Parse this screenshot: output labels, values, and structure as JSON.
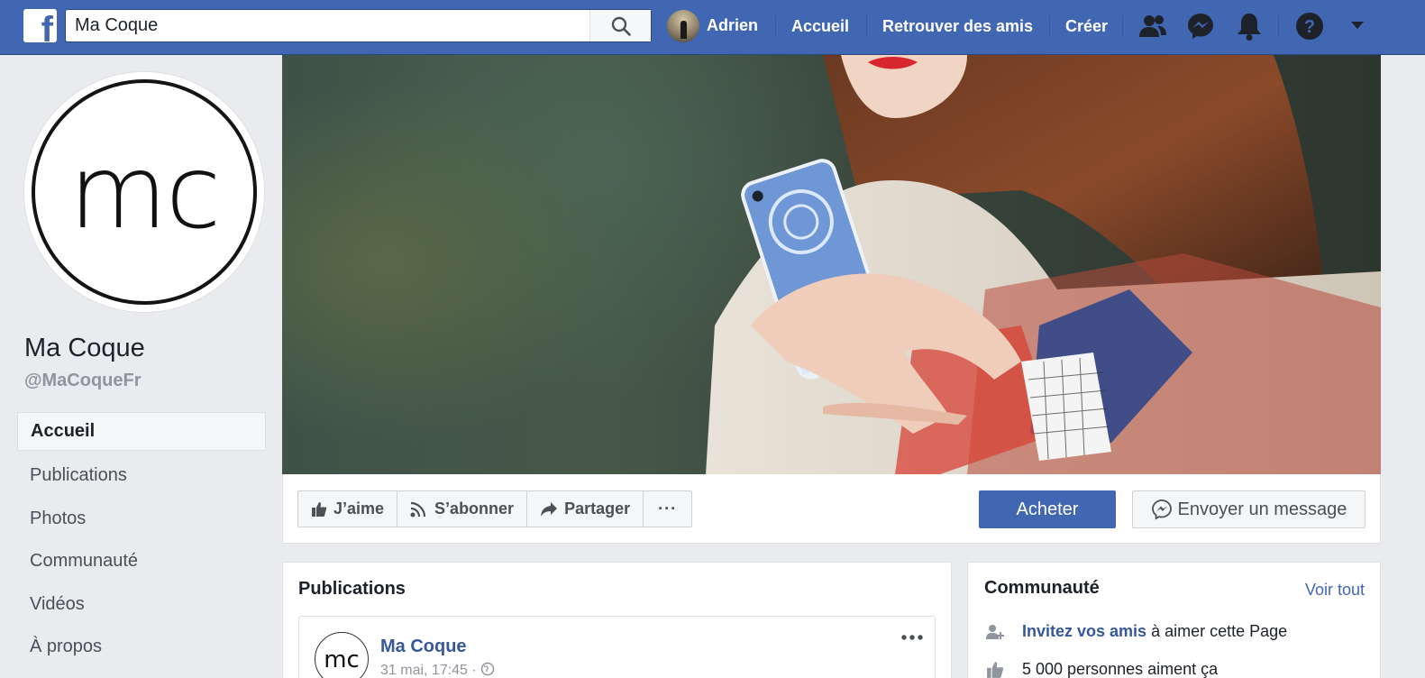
{
  "topbar": {
    "logo": "f",
    "search_value": "Ma Coque",
    "user_name": "Adrien",
    "links": [
      "Accueil",
      "Retrouver des amis",
      "Créer"
    ],
    "icons": [
      "friends-icon",
      "messenger-icon",
      "notifications-icon",
      "help-icon",
      "dropdown-icon"
    ]
  },
  "profile": {
    "logo_text": "mc",
    "name": "Ma Coque",
    "handle": "@MaCoqueFr"
  },
  "leftnav": {
    "items": [
      "Accueil",
      "Publications",
      "Photos",
      "Communauté",
      "Vidéos",
      "À propos"
    ]
  },
  "actions": {
    "like": "J’aime",
    "subscribe": "S’abonner",
    "share": "Partager",
    "more": "···",
    "buy": "Acheter",
    "message": "Envoyer un message"
  },
  "publications": {
    "title": "Publications",
    "post": {
      "author": "Ma Coque",
      "date": "31 mai, 17:45 ·",
      "avatar_text": "mc"
    }
  },
  "community": {
    "title": "Communauté",
    "see_all": "Voir tout",
    "invite_link": "Invitez vos amis",
    "invite_rest": " à aimer cette Page",
    "likes_text": "5 000 personnes aiment ça"
  },
  "colors": {
    "brand": "#4267b2",
    "link": "#365899",
    "background": "#e9ebee"
  }
}
